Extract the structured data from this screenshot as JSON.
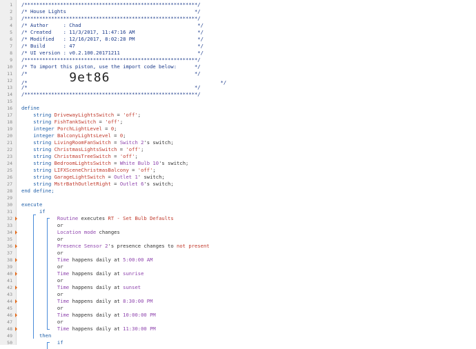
{
  "lines": [
    {
      "n": "1",
      "parts": [
        {
          "t": "/**********************************************************/",
          "c": "blk"
        }
      ]
    },
    {
      "n": "2",
      "parts": [
        {
          "t": "/* House Lights                                           */",
          "c": "blk"
        }
      ]
    },
    {
      "n": "3",
      "parts": [
        {
          "t": "/**********************************************************/",
          "c": "blk"
        }
      ]
    },
    {
      "n": "4",
      "parts": [
        {
          "t": "/* Author     : Chad                                       */",
          "c": "blk"
        }
      ]
    },
    {
      "n": "5",
      "parts": [
        {
          "t": "/* Created    : 11/3/2017, 11:47:16 AM                     */",
          "c": "blk"
        }
      ]
    },
    {
      "n": "6",
      "parts": [
        {
          "t": "/* Modified   : 12/16/2017, 8:02:28 PM                     */",
          "c": "blk"
        }
      ]
    },
    {
      "n": "7",
      "parts": [
        {
          "t": "/* Build      : 47                                         */",
          "c": "blk"
        }
      ]
    },
    {
      "n": "8",
      "parts": [
        {
          "t": "/* UI version : v0.2.100.20171211                          */",
          "c": "blk"
        }
      ]
    },
    {
      "n": "9",
      "parts": [
        {
          "t": "/**********************************************************/",
          "c": "blk"
        }
      ]
    },
    {
      "n": "10",
      "parts": [
        {
          "t": "/* To import this piston, use the import code below:      */",
          "c": "blk"
        }
      ]
    },
    {
      "n": "11",
      "parts": [
        {
          "t": "/*                                                        */",
          "c": "blk"
        }
      ]
    },
    {
      "n": "12",
      "parts": [
        {
          "t": "/*              ",
          "c": "blk"
        },
        {
          "t": "9et86",
          "c": "big"
        },
        {
          "t": "                                     */",
          "c": "blk"
        }
      ]
    },
    {
      "n": "13",
      "parts": [
        {
          "t": "/*                                                        */",
          "c": "blk"
        }
      ]
    },
    {
      "n": "14",
      "parts": [
        {
          "t": "/**********************************************************/",
          "c": "blk"
        }
      ]
    },
    {
      "n": "15",
      "parts": []
    },
    {
      "n": "16",
      "parts": [
        {
          "t": "define",
          "c": "kw"
        }
      ]
    },
    {
      "n": "17",
      "parts": [
        {
          "t": "    string ",
          "c": "kw"
        },
        {
          "t": "DrivewayLightsSwitch",
          "c": "var"
        },
        {
          "t": " = ",
          "c": "op"
        },
        {
          "t": "'off'",
          "c": "str"
        },
        {
          "t": ";",
          "c": "op"
        }
      ]
    },
    {
      "n": "18",
      "parts": [
        {
          "t": "    string ",
          "c": "kw"
        },
        {
          "t": "FishTankSwitch",
          "c": "var"
        },
        {
          "t": " = ",
          "c": "op"
        },
        {
          "t": "'off'",
          "c": "str"
        },
        {
          "t": ";",
          "c": "op"
        }
      ]
    },
    {
      "n": "19",
      "parts": [
        {
          "t": "    integer ",
          "c": "kw"
        },
        {
          "t": "PorchLightLevel",
          "c": "var"
        },
        {
          "t": " = ",
          "c": "op"
        },
        {
          "t": "0",
          "c": "str"
        },
        {
          "t": ";",
          "c": "op"
        }
      ]
    },
    {
      "n": "20",
      "parts": [
        {
          "t": "    integer ",
          "c": "kw"
        },
        {
          "t": "BalconyLightsLevel",
          "c": "var"
        },
        {
          "t": " = ",
          "c": "op"
        },
        {
          "t": "0",
          "c": "str"
        },
        {
          "t": ";",
          "c": "op"
        }
      ]
    },
    {
      "n": "21",
      "parts": [
        {
          "t": "    string ",
          "c": "kw"
        },
        {
          "t": "LivingRoomFanSwitch",
          "c": "var"
        },
        {
          "t": " = ",
          "c": "op"
        },
        {
          "t": "Switch 2",
          "c": "dev"
        },
        {
          "t": "'s switch;",
          "c": "op"
        }
      ]
    },
    {
      "n": "22",
      "parts": [
        {
          "t": "    string ",
          "c": "kw"
        },
        {
          "t": "ChristmasLightsSwitch",
          "c": "var"
        },
        {
          "t": " = ",
          "c": "op"
        },
        {
          "t": "'off'",
          "c": "str"
        },
        {
          "t": ";",
          "c": "op"
        }
      ]
    },
    {
      "n": "23",
      "parts": [
        {
          "t": "    string ",
          "c": "kw"
        },
        {
          "t": "ChristmasTreeSwitch",
          "c": "var"
        },
        {
          "t": " = ",
          "c": "op"
        },
        {
          "t": "'off'",
          "c": "str"
        },
        {
          "t": ";",
          "c": "op"
        }
      ]
    },
    {
      "n": "24",
      "parts": [
        {
          "t": "    string ",
          "c": "kw"
        },
        {
          "t": "BedroomLightsSwitch",
          "c": "var"
        },
        {
          "t": " = ",
          "c": "op"
        },
        {
          "t": "White Bulb 10",
          "c": "dev"
        },
        {
          "t": "'s switch;",
          "c": "op"
        }
      ]
    },
    {
      "n": "25",
      "parts": [
        {
          "t": "    string ",
          "c": "kw"
        },
        {
          "t": "LIFXSceneChristmasBalcony",
          "c": "var"
        },
        {
          "t": " = ",
          "c": "op"
        },
        {
          "t": "'off'",
          "c": "str"
        },
        {
          "t": ";",
          "c": "op"
        }
      ]
    },
    {
      "n": "26",
      "parts": [
        {
          "t": "    string ",
          "c": "kw"
        },
        {
          "t": "GarageLightSwitch",
          "c": "var"
        },
        {
          "t": " = ",
          "c": "op"
        },
        {
          "t": "Outlet 1",
          "c": "dev"
        },
        {
          "t": "' switch;",
          "c": "op"
        }
      ]
    },
    {
      "n": "27",
      "parts": [
        {
          "t": "    string ",
          "c": "kw"
        },
        {
          "t": "MstrBathOutletRight",
          "c": "var"
        },
        {
          "t": " = ",
          "c": "op"
        },
        {
          "t": "Outlet 6",
          "c": "dev"
        },
        {
          "t": "'s switch;",
          "c": "op"
        }
      ]
    },
    {
      "n": "28",
      "parts": [
        {
          "t": "end define;",
          "c": "kw"
        }
      ]
    },
    {
      "n": "29",
      "parts": []
    },
    {
      "n": "30",
      "parts": [
        {
          "t": "execute",
          "c": "kw"
        }
      ]
    },
    {
      "n": "31",
      "parts": [
        {
          "t": "      if",
          "c": "kw"
        }
      ]
    },
    {
      "n": "32",
      "marker": true,
      "parts": [
        {
          "t": "            Routine",
          "c": "dev"
        },
        {
          "t": " executes ",
          "c": "op"
        },
        {
          "t": "RT - Set Bulb Defaults",
          "c": "str"
        }
      ]
    },
    {
      "n": "33",
      "parts": [
        {
          "t": "            or",
          "c": "op"
        }
      ]
    },
    {
      "n": "34",
      "marker": true,
      "parts": [
        {
          "t": "            Location mode",
          "c": "dev"
        },
        {
          "t": " changes",
          "c": "op"
        }
      ]
    },
    {
      "n": "35",
      "parts": [
        {
          "t": "            or",
          "c": "op"
        }
      ]
    },
    {
      "n": "36",
      "marker": true,
      "parts": [
        {
          "t": "            Presence Sensor 2",
          "c": "dev"
        },
        {
          "t": "'s presence changes to ",
          "c": "op"
        },
        {
          "t": "not present",
          "c": "str"
        }
      ]
    },
    {
      "n": "37",
      "parts": [
        {
          "t": "            or",
          "c": "op"
        }
      ]
    },
    {
      "n": "38",
      "marker": true,
      "parts": [
        {
          "t": "            Time",
          "c": "dev"
        },
        {
          "t": " happens daily at ",
          "c": "op"
        },
        {
          "t": "5:00:00 AM",
          "c": "val"
        }
      ]
    },
    {
      "n": "39",
      "parts": [
        {
          "t": "            or",
          "c": "op"
        }
      ]
    },
    {
      "n": "40",
      "marker": true,
      "parts": [
        {
          "t": "            Time",
          "c": "dev"
        },
        {
          "t": " happens daily at ",
          "c": "op"
        },
        {
          "t": "sunrise",
          "c": "val"
        }
      ]
    },
    {
      "n": "41",
      "parts": [
        {
          "t": "            or",
          "c": "op"
        }
      ]
    },
    {
      "n": "42",
      "marker": true,
      "parts": [
        {
          "t": "            Time",
          "c": "dev"
        },
        {
          "t": " happens daily at ",
          "c": "op"
        },
        {
          "t": "sunset",
          "c": "val"
        }
      ]
    },
    {
      "n": "43",
      "parts": [
        {
          "t": "            or",
          "c": "op"
        }
      ]
    },
    {
      "n": "44",
      "marker": true,
      "parts": [
        {
          "t": "            Time",
          "c": "dev"
        },
        {
          "t": " happens daily at ",
          "c": "op"
        },
        {
          "t": "8:30:00 PM",
          "c": "val"
        }
      ]
    },
    {
      "n": "45",
      "parts": [
        {
          "t": "            or",
          "c": "op"
        }
      ]
    },
    {
      "n": "46",
      "marker": true,
      "parts": [
        {
          "t": "            Time",
          "c": "dev"
        },
        {
          "t": " happens daily at ",
          "c": "op"
        },
        {
          "t": "10:00:00 PM",
          "c": "val"
        }
      ]
    },
    {
      "n": "47",
      "parts": [
        {
          "t": "            or",
          "c": "op"
        }
      ]
    },
    {
      "n": "48",
      "marker": true,
      "parts": [
        {
          "t": "            Time",
          "c": "dev"
        },
        {
          "t": " happens daily at ",
          "c": "op"
        },
        {
          "t": "11:30:00 PM",
          "c": "val"
        }
      ]
    },
    {
      "n": "49",
      "parts": [
        {
          "t": "      then",
          "c": "kw"
        }
      ]
    },
    {
      "n": "50",
      "parts": [
        {
          "t": "            if",
          "c": "kw"
        }
      ]
    }
  ]
}
